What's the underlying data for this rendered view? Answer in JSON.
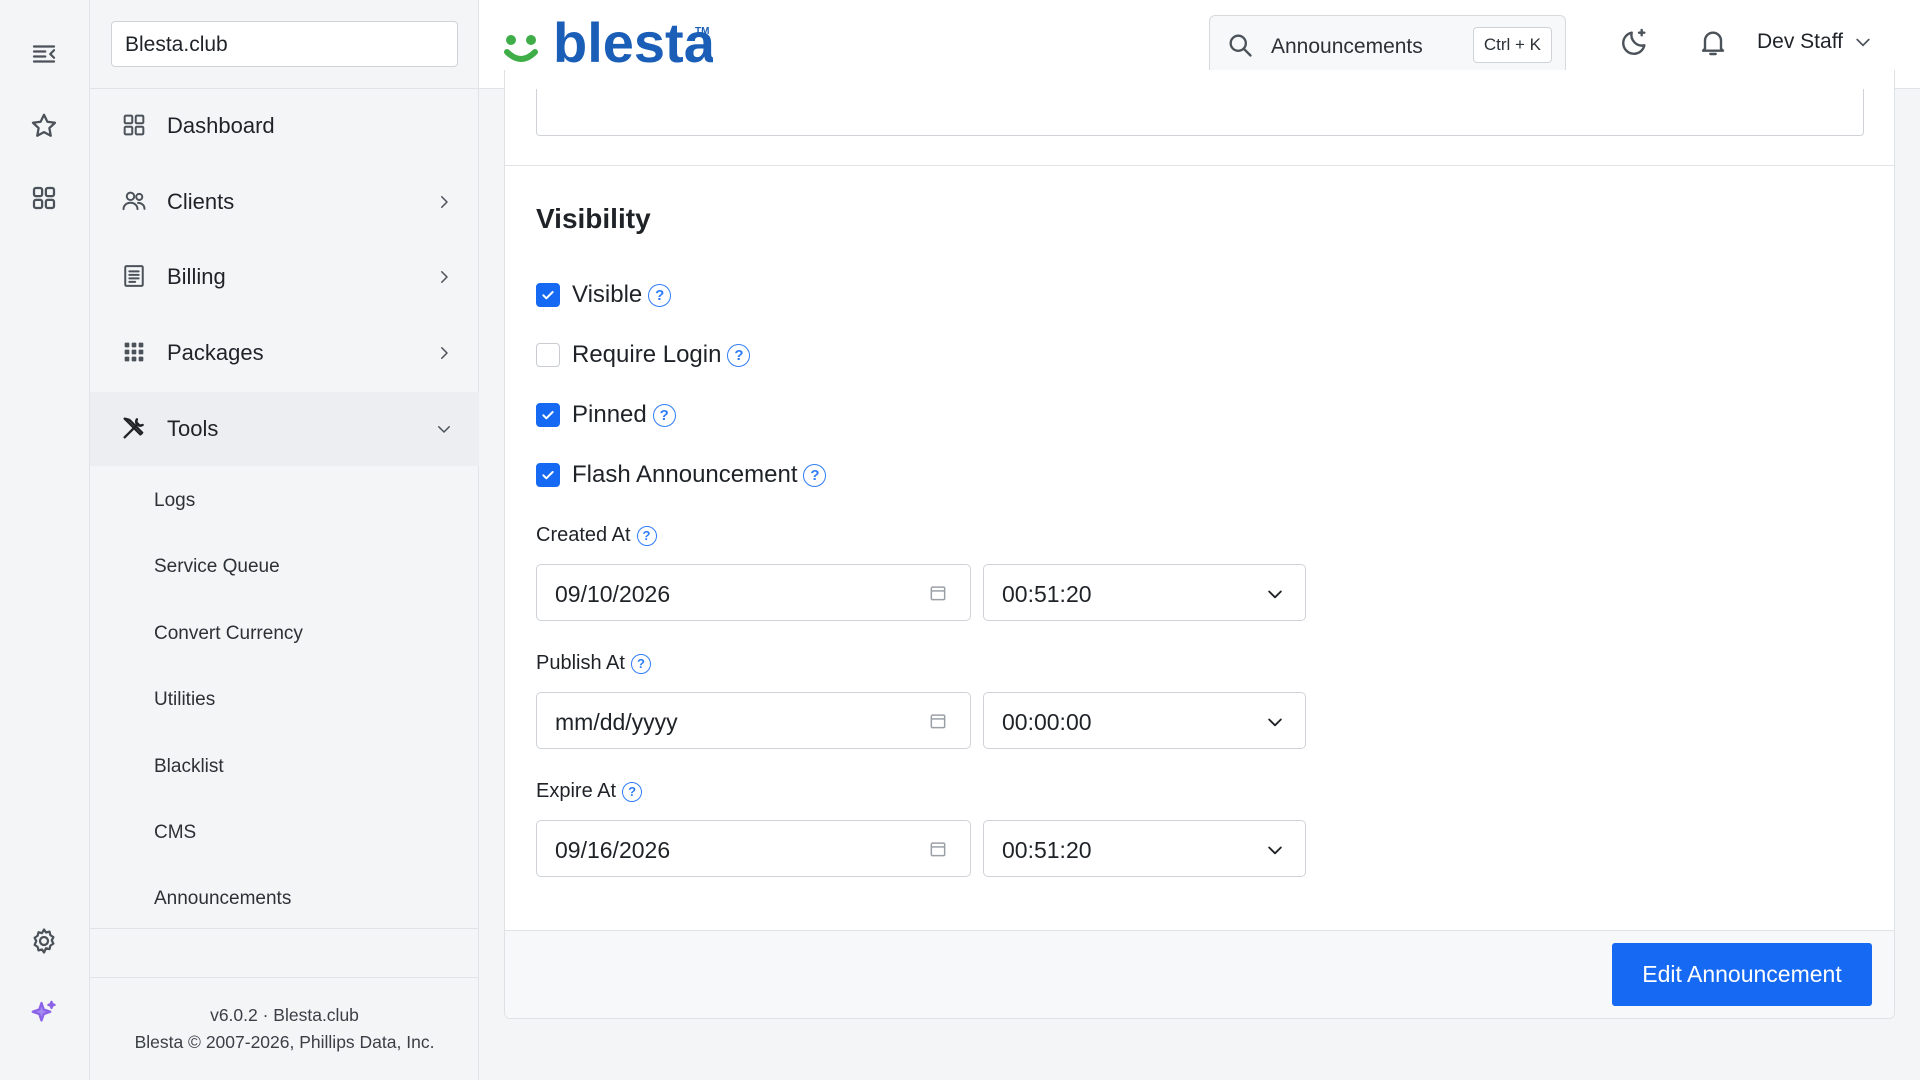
{
  "sidebar": {
    "company": "Blesta.club",
    "nav": [
      {
        "label": "Dashboard",
        "icon": "dashboard-icon"
      },
      {
        "label": "Clients",
        "icon": "users-icon"
      },
      {
        "label": "Billing",
        "icon": "billing-icon"
      },
      {
        "label": "Packages",
        "icon": "packages-icon"
      },
      {
        "label": "Tools",
        "icon": "tools-icon"
      }
    ],
    "tools_sub": [
      "Logs",
      "Service Queue",
      "Convert Currency",
      "Utilities",
      "Blacklist",
      "CMS",
      "Announcements"
    ],
    "footer": {
      "version": "v6.0.2 · Blesta.club",
      "copyright": "Blesta © 2007-2026, Phillips Data, Inc."
    }
  },
  "header": {
    "logo_text": "blesta",
    "logo_tm": "TM",
    "search": {
      "text": "Announcements",
      "shortcut": "Ctrl + K"
    },
    "user": "Dev Staff"
  },
  "form": {
    "section_title": "Visibility",
    "checkboxes": [
      {
        "label": "Visible",
        "checked": true
      },
      {
        "label": "Require Login",
        "checked": false
      },
      {
        "label": "Pinned",
        "checked": true
      },
      {
        "label": "Flash Announcement",
        "checked": true
      }
    ],
    "help_glyph": "?",
    "created_at": {
      "label": "Created At",
      "date": "09/10/2026",
      "time": "00:51:20"
    },
    "publish_at": {
      "label": "Publish At",
      "date": "mm/dd/yyyy",
      "time": "00:00:00"
    },
    "expire_at": {
      "label": "Expire At",
      "date": "09/16/2026",
      "time": "00:51:20"
    },
    "submit_label": "Edit Announcement"
  },
  "colors": {
    "accent": "#1669f2",
    "logo_blue": "#1a5eb8",
    "logo_green": "#3fae49"
  }
}
